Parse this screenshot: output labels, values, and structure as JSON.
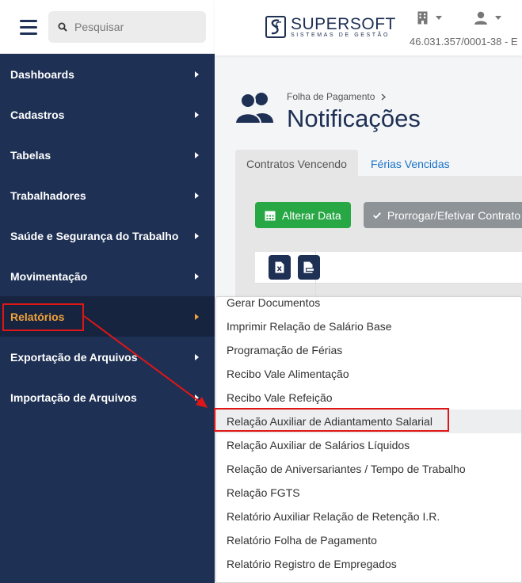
{
  "search": {
    "placeholder": "Pesquisar"
  },
  "sidebar": {
    "items": [
      {
        "label": "Dashboards"
      },
      {
        "label": "Cadastros"
      },
      {
        "label": "Tabelas"
      },
      {
        "label": "Trabalhadores"
      },
      {
        "label": "Saúde e Segurança do Trabalho"
      },
      {
        "label": "Movimentação"
      },
      {
        "label": "Relatórios"
      },
      {
        "label": "Exportação de Arquivos"
      },
      {
        "label": "Importação de Arquivos"
      }
    ],
    "active": "Relatórios"
  },
  "header": {
    "brand": "SUPERSOFT",
    "brand_sub": "SISTEMAS DE GESTÃO",
    "cnpj": "46.031.357/0001-38 - E"
  },
  "page": {
    "breadcrumb": "Folha de Pagamento",
    "title": "Notificações"
  },
  "tabs": [
    {
      "label": "Contratos Vencendo"
    },
    {
      "label": "Férias Vencidas"
    }
  ],
  "toolbar": {
    "alterar_label": "Alterar Data",
    "prorrogar_label": "Prorrogar/Efetivar Contrato"
  },
  "dropdown": {
    "items": [
      {
        "label": "Gerar Documentos"
      },
      {
        "label": "Imprimir Relação de Salário Base"
      },
      {
        "label": "Programação de Férias"
      },
      {
        "label": "Recibo Vale Alimentação"
      },
      {
        "label": "Recibo Vale Refeição"
      },
      {
        "label": "Relação Auxiliar de Adiantamento Salarial"
      },
      {
        "label": "Relação Auxiliar de Salários Líquidos"
      },
      {
        "label": "Relação de Aniversariantes / Tempo de Trabalho"
      },
      {
        "label": "Relação FGTS"
      },
      {
        "label": "Relatório Auxiliar Relação de Retenção I.R."
      },
      {
        "label": "Relatório Folha de Pagamento"
      },
      {
        "label": "Relatório Registro de Empregados"
      }
    ],
    "highlighted": "Relação Auxiliar de Adiantamento Salarial"
  },
  "colors": {
    "sidebar_bg": "#1e3054",
    "active_text": "#f0a13a",
    "success": "#28a745",
    "annotation": "#e01616",
    "link": "#1a73c8"
  },
  "icons": [
    "menu-icon",
    "search-icon",
    "building-icon",
    "user-icon",
    "users-icon",
    "calendar-icon",
    "check-icon",
    "xls-file-icon",
    "csv-file-icon",
    "chevron-right-icon"
  ]
}
